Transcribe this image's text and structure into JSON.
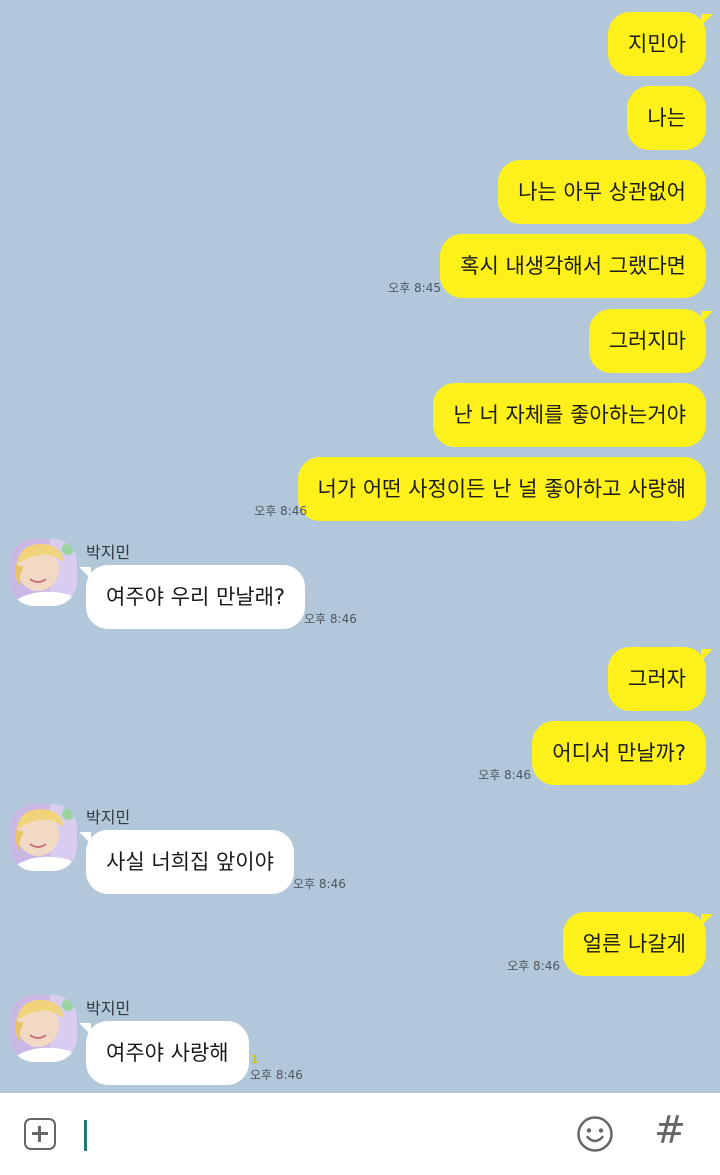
{
  "contact": {
    "name": "박지민"
  },
  "messages": [
    {
      "dir": "out",
      "text": "지민아",
      "time": ""
    },
    {
      "dir": "out",
      "text": "나는",
      "time": ""
    },
    {
      "dir": "out",
      "text": "나는 아무 상관없어",
      "time": ""
    },
    {
      "dir": "out",
      "text": "혹시 내생각해서 그랬다면",
      "time": "오후 8:45"
    },
    {
      "dir": "out",
      "text": "그러지마",
      "time": ""
    },
    {
      "dir": "out",
      "text": "난 너 자체를 좋아하는거야",
      "time": ""
    },
    {
      "dir": "out",
      "text": "너가 어떤 사정이든 난 널 좋아하고 사랑해",
      "time": "오후 8:46"
    },
    {
      "dir": "in",
      "sender": "박지민",
      "text": "여주야 우리 만날래?",
      "time": "오후 8:46"
    },
    {
      "dir": "out",
      "text": "그러자",
      "time": ""
    },
    {
      "dir": "out",
      "text": "어디서 만날까?",
      "time": "오후 8:46"
    },
    {
      "dir": "in",
      "sender": "박지민",
      "text": "사실 너희집 앞이야",
      "time": "오후 8:46"
    },
    {
      "dir": "out",
      "text": "얼른 나갈게",
      "time": "오후 8:46"
    },
    {
      "dir": "in",
      "sender": "박지민",
      "text": "여주야 사랑해",
      "time": "오후 8:46",
      "unread": "1"
    }
  ],
  "input": {
    "placeholder": "",
    "value": "",
    "icons": [
      "plus-icon",
      "emoji-icon",
      "hash-icon"
    ],
    "hash_symbol": "#"
  },
  "colors": {
    "background": "#b2c7da",
    "outgoing_bubble": "#fef01b",
    "incoming_bubble": "#ffffff",
    "input_bar": "#ffffff",
    "cursor": "#1e7d78"
  }
}
